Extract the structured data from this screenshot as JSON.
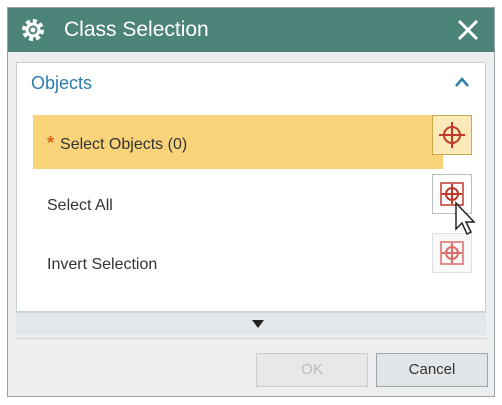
{
  "dialog": {
    "title": "Class Selection",
    "title_icon": "gear-icon",
    "close_icon": "close-icon"
  },
  "group": {
    "title": "Objects",
    "collapse_icon": "chevron-up-icon"
  },
  "rows": [
    {
      "label": "Select Objects (0)",
      "required": true,
      "selected": true,
      "icon": "crosshair-icon"
    },
    {
      "label": "Select All",
      "required": false,
      "selected": false,
      "icon": "select-all-crosshair-icon"
    },
    {
      "label": "Invert Selection",
      "required": false,
      "selected": false,
      "icon": "invert-selection-crosshair-icon"
    }
  ],
  "expand_icon": "triangle-down-icon",
  "buttons": {
    "ok": "OK",
    "cancel": "Cancel"
  },
  "colors": {
    "titlebar": "#4d8479",
    "highlight": "#f8d37a",
    "group_title": "#2f7cae",
    "required_star": "#e0641c"
  }
}
